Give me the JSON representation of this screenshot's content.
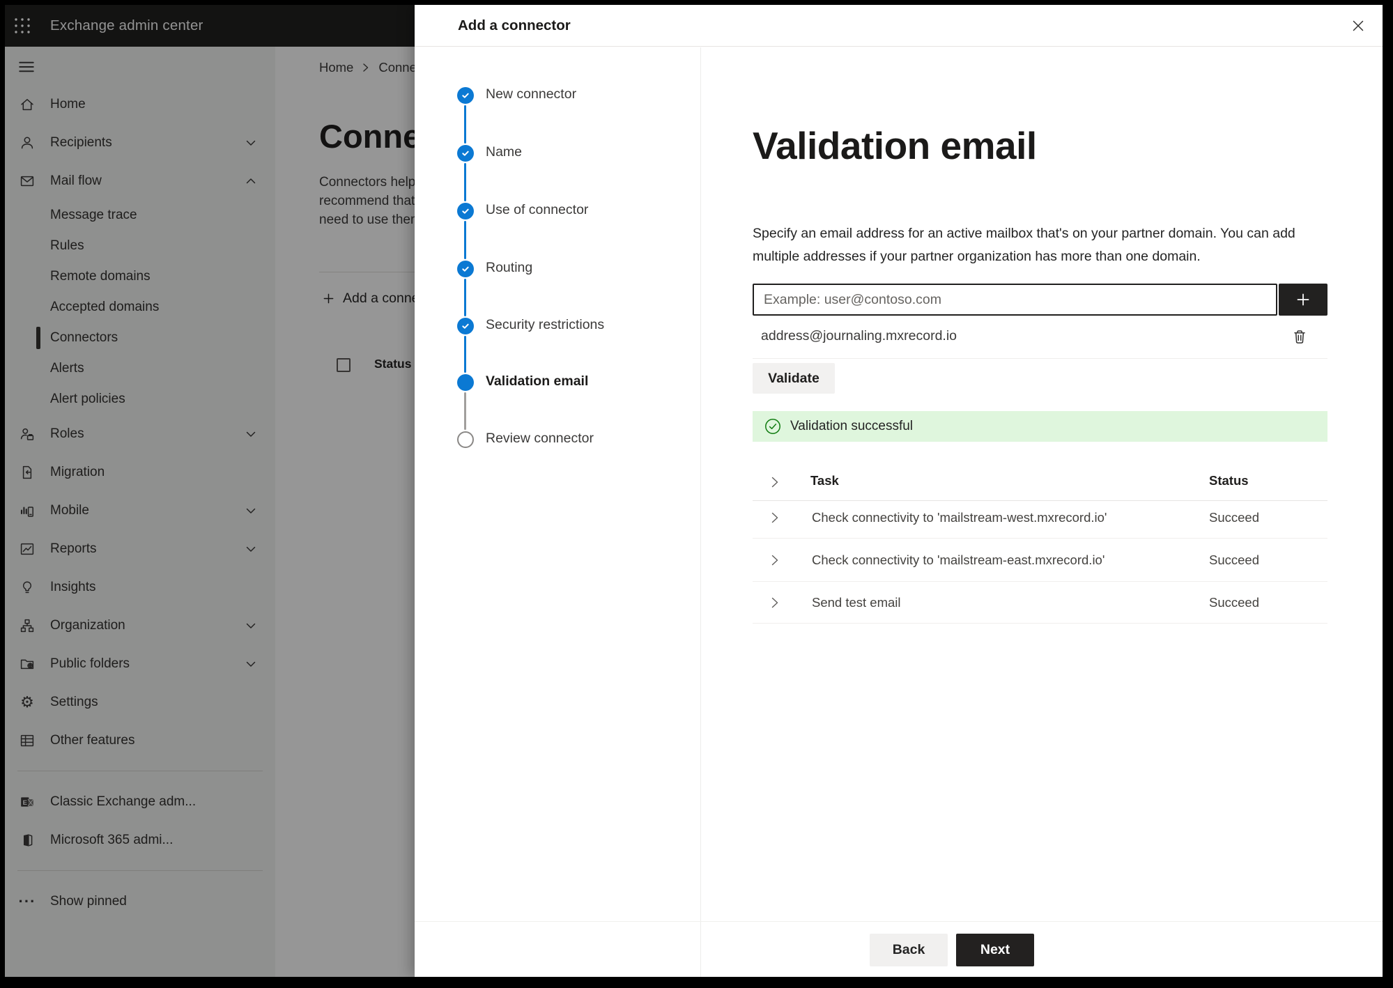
{
  "colors": {
    "accent_blue": "#0b79d3",
    "success_green": "#107c10",
    "success_banner_bg": "#dff6dd",
    "topbar_bg": "#20201f",
    "primary_button_bg": "#232120"
  },
  "window": {
    "app_title": "Exchange admin center"
  },
  "sidebar": {
    "items": [
      {
        "icon": "home-icon",
        "label": "Home"
      },
      {
        "icon": "person-icon",
        "label": "Recipients",
        "chevron": "down"
      },
      {
        "icon": "mail-icon",
        "label": "Mail flow",
        "chevron": "up"
      },
      {
        "label": "Message trace",
        "child": true
      },
      {
        "label": "Rules",
        "child": true
      },
      {
        "label": "Remote domains",
        "child": true
      },
      {
        "label": "Accepted domains",
        "child": true
      },
      {
        "label": "Connectors",
        "child": true,
        "selected": true
      },
      {
        "label": "Alerts",
        "child": true
      },
      {
        "label": "Alert policies",
        "child": true
      },
      {
        "icon": "roles-icon",
        "label": "Roles",
        "chevron": "down"
      },
      {
        "icon": "migration-icon",
        "label": "Migration"
      },
      {
        "icon": "mobile-icon",
        "label": "Mobile",
        "chevron": "down"
      },
      {
        "icon": "reports-icon",
        "label": "Reports",
        "chevron": "down"
      },
      {
        "icon": "insights-icon",
        "label": "Insights"
      },
      {
        "icon": "organization-icon",
        "label": "Organization",
        "chevron": "down"
      },
      {
        "icon": "public-folders-icon",
        "label": "Public folders",
        "chevron": "down"
      },
      {
        "icon": "settings-icon",
        "label": "Settings"
      },
      {
        "icon": "other-features-icon",
        "label": "Other features"
      },
      {
        "divider": true
      },
      {
        "icon": "classic-exchange-icon",
        "label": "Classic Exchange adm..."
      },
      {
        "icon": "m365-icon",
        "label": "Microsoft 365 admi..."
      },
      {
        "divider": true
      },
      {
        "icon": "ellipsis-icon",
        "label": "Show pinned"
      }
    ]
  },
  "background_page": {
    "breadcrumb_home": "Home",
    "breadcrumb_current": "Connectors",
    "title": "Connectors",
    "description_lines": [
      "Connectors help",
      "recommend that",
      "need to use them"
    ],
    "add_button_label": "Add a connector",
    "status_column_header": "Status"
  },
  "dialog": {
    "title": "Add a connector",
    "steps": [
      {
        "label": "New connector",
        "state": "completed"
      },
      {
        "label": "Name",
        "state": "completed"
      },
      {
        "label": "Use of connector",
        "state": "completed"
      },
      {
        "label": "Routing",
        "state": "completed"
      },
      {
        "label": "Security restrictions",
        "state": "completed"
      },
      {
        "label": "Validation email",
        "state": "current"
      },
      {
        "label": "Review connector",
        "state": "upcoming"
      }
    ],
    "main": {
      "heading": "Validation email",
      "description": "Specify an email address for an active mailbox that's on your partner domain. You can add multiple addresses if your partner organization has more than one domain.",
      "email_input": {
        "value": "",
        "placeholder": "Example: user@contoso.com"
      },
      "added_address": "address@journaling.mxrecord.io",
      "validate_button": "Validate",
      "validation_banner": "Validation successful",
      "table": {
        "columns": [
          "Task",
          "Status"
        ],
        "rows": [
          {
            "task": "Check connectivity to 'mailstream-west.mxrecord.io'",
            "status": "Succeed"
          },
          {
            "task": "Check connectivity to 'mailstream-east.mxrecord.io'",
            "status": "Succeed"
          },
          {
            "task": "Send test email",
            "status": "Succeed"
          }
        ]
      }
    },
    "footer": {
      "back_label": "Back",
      "next_label": "Next"
    }
  }
}
